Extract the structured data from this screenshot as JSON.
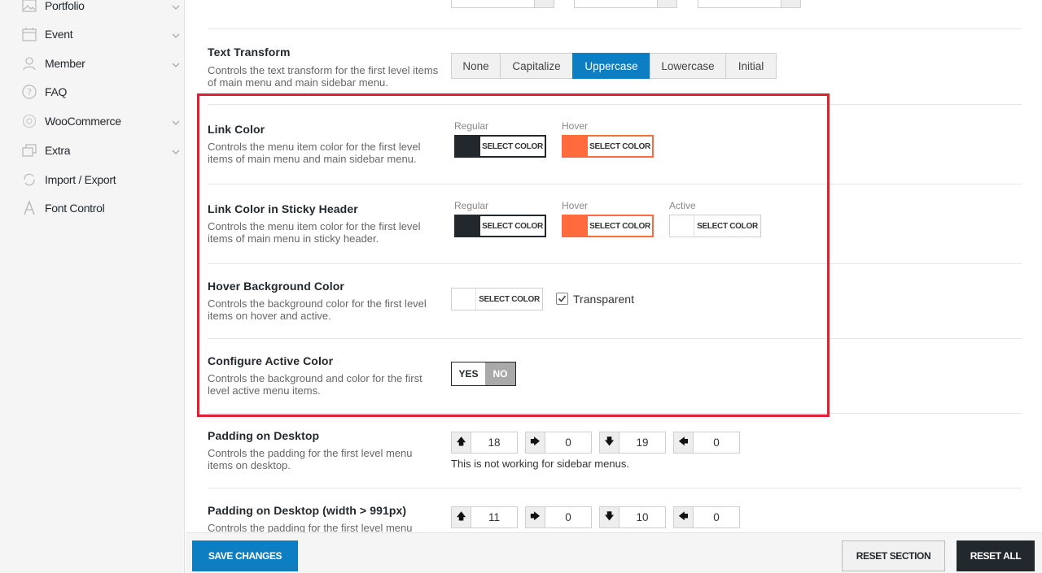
{
  "sidebar": {
    "items": [
      {
        "label": "Portfolio",
        "icon": "image-icon",
        "has_chevron": true
      },
      {
        "label": "Event",
        "icon": "calendar-icon",
        "has_chevron": true
      },
      {
        "label": "Member",
        "icon": "user-icon",
        "has_chevron": true
      },
      {
        "label": "FAQ",
        "icon": "question-icon",
        "has_chevron": false
      },
      {
        "label": "WooCommerce",
        "icon": "woocommerce-icon",
        "has_chevron": true
      },
      {
        "label": "Extra",
        "icon": "stack-icon",
        "has_chevron": true
      },
      {
        "label": "Import / Export",
        "icon": "refresh-icon",
        "has_chevron": false
      },
      {
        "label": "Font Control",
        "icon": "font-icon",
        "has_chevron": false
      }
    ]
  },
  "text_transform": {
    "title": "Text Transform",
    "desc": "Controls the text transform for the first level items of main menu and main sidebar menu.",
    "options": [
      "None",
      "Capitalize",
      "Uppercase",
      "Lowercase",
      "Initial"
    ],
    "selected": "Uppercase"
  },
  "link_color": {
    "title": "Link Color",
    "desc": "Controls the menu item color for the first level items of main menu and main sidebar menu.",
    "regular_label": "Regular",
    "hover_label": "Hover",
    "button_label": "SELECT COLOR",
    "regular_color": "#23282d",
    "hover_color": "#ff6b3d"
  },
  "sticky_link_color": {
    "title": "Link Color in Sticky Header",
    "desc": "Controls the menu item color for the first level items of main menu in sticky header.",
    "regular_label": "Regular",
    "hover_label": "Hover",
    "active_label": "Active",
    "button_label": "SELECT COLOR"
  },
  "hover_bg": {
    "title": "Hover Background Color",
    "desc": "Controls the background color for the first level items on hover and active.",
    "button_label": "SELECT COLOR",
    "transparent_label": "Transparent",
    "transparent_checked": true
  },
  "active_color": {
    "title": "Configure Active Color",
    "desc": "Controls the background and color for the first level active menu items.",
    "yes_label": "YES",
    "no_label": "NO",
    "selected": "YES"
  },
  "padding_desktop": {
    "title": "Padding on Desktop",
    "desc": "Controls the padding for the first level menu items on desktop.",
    "values": [
      "18",
      "0",
      "19",
      "0"
    ],
    "note": "This is not working for sidebar menus."
  },
  "padding_desktop_991": {
    "title": "Padding on Desktop (width > 991px)",
    "desc": "Controls the padding for the first level menu",
    "values": [
      "11",
      "0",
      "10",
      "0"
    ]
  },
  "footer": {
    "save_label": "SAVE CHANGES",
    "reset_section_label": "RESET SECTION",
    "reset_all_label": "RESET ALL"
  },
  "colors": {
    "accent": "#0d7ec1",
    "dark": "#23282d",
    "orange": "#ff6b3d",
    "highlight": "#e0202e"
  }
}
